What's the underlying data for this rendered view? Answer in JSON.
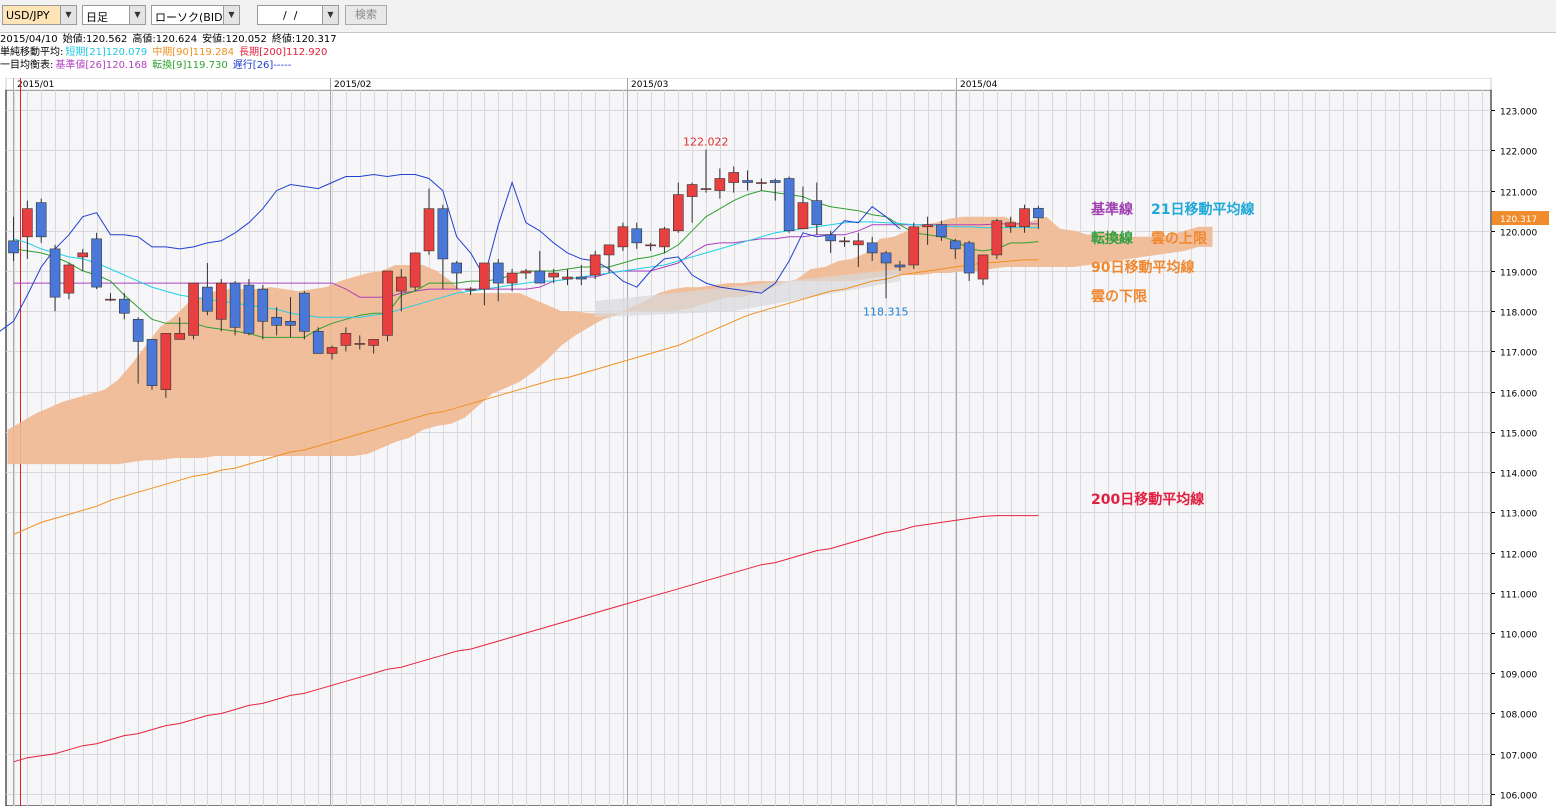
{
  "toolbar": {
    "symbol": "USD/JPY",
    "period": "日足",
    "chart_type": "ローソク(BID)",
    "date_value": "  /  /",
    "search_label": "検索"
  },
  "info": {
    "date": "2015/04/10",
    "open": "始値:120.562",
    "high": "高値:120.624",
    "low": "安値:120.052",
    "close": "終値:120.317",
    "sma_label": "単純移動平均:",
    "sma_short": "短期[21]120.079",
    "sma_mid": "中期[90]119.284",
    "sma_long": "長期[200]112.920",
    "ichimoku_label": "一目均衡表:",
    "kijun": "基準値[26]120.168",
    "tenkan": "転換[9]119.730",
    "chikou": "遅行[26]-----"
  },
  "colors": {
    "up": "#e84040",
    "down": "#4a78d8",
    "cloud": "#f0b890",
    "sma21": "#20d0e8",
    "sma90": "#f09020",
    "sma200": "#e8203c",
    "kijun": "#b040c0",
    "tenkan": "#30a030",
    "chikou": "#2040d0",
    "price_tag": "#f08c2c"
  },
  "annotations": {
    "kijun": "基準線",
    "sma21": "21日移動平均線",
    "tenkan": "転換線",
    "cloud_upper": "雲の上限",
    "sma90": "90日移動平均線",
    "cloud_lower": "雲の下限",
    "sma200": "200日移動平均線"
  },
  "chart_data": {
    "type": "candlestick",
    "title": "",
    "x_labels": [
      "2015/01",
      "2015/02",
      "2015/03",
      "2015/04"
    ],
    "y_ticks": [
      "123.000",
      "122.000",
      "121.000",
      "120.000",
      "119.000",
      "118.000",
      "117.000",
      "116.000",
      "115.000",
      "114.000",
      "113.000",
      "112.000",
      "111.000",
      "110.000",
      "109.000",
      "108.000",
      "107.000",
      "106.000"
    ],
    "ylim": [
      105.7,
      123.5
    ],
    "current_price": "120.317",
    "high_label": "122.022",
    "low_label": "118.315",
    "candles": [
      [
        119.75,
        120.35,
        119.25,
        119.45
      ],
      [
        119.85,
        120.75,
        119.3,
        120.55
      ],
      [
        120.7,
        120.8,
        119.7,
        119.85
      ],
      [
        119.55,
        119.65,
        118.0,
        118.35
      ],
      [
        118.45,
        119.2,
        118.3,
        119.15
      ],
      [
        119.35,
        119.55,
        119.0,
        119.45
      ],
      [
        119.8,
        119.95,
        118.55,
        118.6
      ],
      [
        118.3,
        118.45,
        118.25,
        118.3
      ],
      [
        118.3,
        118.45,
        117.8,
        117.95
      ],
      [
        117.8,
        117.85,
        116.2,
        117.25
      ],
      [
        117.3,
        117.3,
        116.05,
        116.15
      ],
      [
        116.05,
        117.35,
        115.85,
        117.45
      ],
      [
        117.3,
        117.85,
        117.3,
        117.45
      ],
      [
        117.4,
        118.7,
        117.3,
        118.7
      ],
      [
        118.6,
        119.2,
        117.9,
        118.0
      ],
      [
        117.8,
        118.8,
        117.5,
        118.7
      ],
      [
        118.7,
        118.75,
        117.4,
        117.6
      ],
      [
        118.65,
        118.8,
        117.4,
        117.45
      ],
      [
        118.55,
        118.65,
        117.3,
        117.75
      ],
      [
        117.85,
        118.1,
        117.4,
        117.65
      ],
      [
        117.75,
        118.35,
        117.35,
        117.65
      ],
      [
        118.45,
        118.5,
        117.3,
        117.5
      ],
      [
        117.5,
        117.6,
        116.95,
        116.95
      ],
      [
        116.95,
        117.15,
        116.8,
        117.1
      ],
      [
        117.15,
        117.6,
        117.0,
        117.45
      ],
      [
        117.2,
        117.4,
        117.05,
        117.2
      ],
      [
        117.15,
        117.3,
        116.95,
        117.3
      ],
      [
        117.4,
        118.75,
        117.25,
        119.0
      ],
      [
        118.5,
        119.05,
        118.0,
        118.85
      ],
      [
        118.6,
        119.45,
        118.5,
        119.45
      ],
      [
        119.5,
        121.05,
        119.4,
        120.55
      ],
      [
        120.55,
        120.65,
        118.55,
        119.3
      ],
      [
        119.2,
        119.25,
        118.55,
        118.95
      ],
      [
        118.55,
        118.6,
        118.4,
        118.55
      ],
      [
        118.55,
        119.1,
        118.15,
        119.2
      ],
      [
        119.2,
        119.3,
        118.25,
        118.7
      ],
      [
        118.7,
        119.05,
        118.5,
        118.95
      ],
      [
        118.95,
        119.05,
        118.8,
        119.0
      ],
      [
        119.0,
        119.5,
        118.7,
        118.7
      ],
      [
        118.85,
        119.05,
        118.7,
        118.95
      ],
      [
        118.8,
        119.05,
        118.65,
        118.85
      ],
      [
        118.85,
        119.15,
        118.65,
        118.8
      ],
      [
        118.9,
        119.5,
        118.8,
        119.4
      ],
      [
        119.4,
        119.65,
        118.95,
        119.65
      ],
      [
        119.6,
        120.2,
        119.5,
        120.1
      ],
      [
        120.05,
        120.2,
        119.55,
        119.7
      ],
      [
        119.65,
        119.7,
        119.5,
        119.65
      ],
      [
        119.6,
        120.1,
        119.45,
        120.05
      ],
      [
        120.0,
        121.2,
        119.95,
        120.9
      ],
      [
        120.85,
        121.2,
        120.2,
        121.15
      ],
      [
        121.05,
        122.02,
        120.95,
        121.05
      ],
      [
        121.0,
        121.55,
        120.8,
        121.3
      ],
      [
        121.2,
        121.6,
        120.95,
        121.45
      ],
      [
        121.25,
        121.5,
        121.0,
        121.2
      ],
      [
        121.2,
        121.3,
        121.0,
        121.2
      ],
      [
        121.25,
        121.3,
        120.75,
        121.2
      ],
      [
        121.3,
        121.35,
        119.95,
        120.0
      ],
      [
        120.05,
        121.1,
        120.05,
        120.7
      ],
      [
        120.75,
        121.2,
        119.9,
        120.15
      ],
      [
        119.9,
        120.0,
        119.45,
        119.75
      ],
      [
        119.75,
        119.85,
        119.6,
        119.75
      ],
      [
        119.65,
        119.95,
        119.1,
        119.75
      ],
      [
        119.7,
        119.85,
        119.25,
        119.45
      ],
      [
        119.45,
        119.5,
        118.32,
        119.2
      ],
      [
        119.15,
        119.25,
        119.0,
        119.1
      ],
      [
        119.15,
        120.2,
        119.05,
        120.1
      ],
      [
        120.1,
        120.35,
        119.65,
        120.15
      ],
      [
        120.15,
        120.25,
        119.75,
        119.85
      ],
      [
        119.75,
        119.8,
        119.3,
        119.55
      ],
      [
        119.7,
        119.75,
        118.75,
        118.95
      ],
      [
        118.8,
        119.4,
        118.65,
        119.4
      ],
      [
        119.4,
        120.3,
        119.3,
        120.25
      ],
      [
        120.1,
        120.35,
        119.95,
        120.2
      ],
      [
        120.1,
        120.65,
        119.95,
        120.55
      ],
      [
        120.56,
        120.62,
        120.05,
        120.32
      ]
    ],
    "sma21": [
      119.8,
      119.7,
      119.55,
      119.45,
      119.35,
      119.3,
      119.2,
      119.05,
      118.9,
      118.75,
      118.6,
      118.5,
      118.4,
      118.35,
      118.3,
      118.25,
      118.2,
      118.15,
      118.1,
      118.05,
      117.95,
      117.9,
      117.85,
      117.85,
      117.85,
      117.85,
      117.9,
      117.95,
      118.05,
      118.15,
      118.25,
      118.35,
      118.45,
      118.5,
      118.55,
      118.6,
      118.65,
      118.7,
      118.75,
      118.75,
      118.8,
      118.85,
      118.9,
      118.95,
      119.0,
      119.05,
      119.1,
      119.15,
      119.25,
      119.35,
      119.45,
      119.55,
      119.65,
      119.75,
      119.85,
      119.95,
      120.0,
      120.05,
      120.1,
      120.15,
      120.2,
      120.22,
      120.22,
      120.2,
      120.18,
      120.15,
      120.15,
      120.12,
      120.1,
      120.1,
      120.08,
      120.08,
      120.08,
      120.08,
      120.08
    ],
    "kijun": [
      118.7,
      118.7,
      118.7,
      118.7,
      118.7,
      118.7,
      118.7,
      118.7,
      118.7,
      118.7,
      118.7,
      118.7,
      118.7,
      118.7,
      118.7,
      118.7,
      118.7,
      118.7,
      118.7,
      118.7,
      118.7,
      118.7,
      118.7,
      118.7,
      118.55,
      118.35,
      118.35,
      118.35,
      118.45,
      118.5,
      118.55,
      118.55,
      118.55,
      118.55,
      118.55,
      118.55,
      118.55,
      118.55,
      118.6,
      118.75,
      118.8,
      118.85,
      118.85,
      118.95,
      119.0,
      119.0,
      119.0,
      119.1,
      119.2,
      119.45,
      119.65,
      119.7,
      119.7,
      119.75,
      119.8,
      119.8,
      119.85,
      119.85,
      119.9,
      119.9,
      119.9,
      120.0,
      120.15,
      120.15,
      120.15,
      120.15,
      120.15,
      120.15,
      120.15,
      120.15,
      120.15,
      120.17,
      120.17,
      120.17,
      120.17
    ],
    "tenkan": [
      119.55,
      119.5,
      119.45,
      119.35,
      119.2,
      119.0,
      118.9,
      118.75,
      118.4,
      118.1,
      117.8,
      117.7,
      117.7,
      117.7,
      117.6,
      117.55,
      117.5,
      117.45,
      117.35,
      117.35,
      117.35,
      117.35,
      117.55,
      117.7,
      117.8,
      117.9,
      117.95,
      117.95,
      118.4,
      118.5,
      118.7,
      118.7,
      118.7,
      118.75,
      118.75,
      118.8,
      118.9,
      119.0,
      119.0,
      119.0,
      119.05,
      119.1,
      119.1,
      119.1,
      119.2,
      119.3,
      119.35,
      119.45,
      119.65,
      120.0,
      120.35,
      120.55,
      120.75,
      120.9,
      121.0,
      120.95,
      120.9,
      120.85,
      120.7,
      120.6,
      120.55,
      120.5,
      120.4,
      120.35,
      120.15,
      119.95,
      119.9,
      119.85,
      119.75,
      119.55,
      119.5,
      119.55,
      119.7,
      119.7,
      119.73
    ],
    "chikou": [
      117.5,
      117.75,
      118.4,
      119.1,
      119.55,
      119.9,
      120.35,
      120.45,
      119.9,
      119.9,
      119.85,
      119.6,
      119.6,
      119.55,
      119.6,
      119.7,
      119.75,
      119.95,
      120.2,
      120.55,
      121.0,
      121.15,
      121.1,
      121.05,
      121.2,
      121.35,
      121.35,
      121.4,
      121.35,
      121.4,
      121.4,
      121.3,
      121.0,
      119.85,
      119.45,
      118.85,
      120.15,
      121.2,
      120.2,
      120.0,
      119.7,
      119.45,
      119.3,
      119.25,
      119.05,
      118.75,
      118.6,
      119.0,
      119.3,
      119.35,
      118.9,
      118.7,
      118.6,
      118.55,
      118.5,
      118.45,
      118.7,
      119.25,
      119.95,
      119.85,
      119.9,
      120.25,
      120.2,
      120.6,
      120.35,
      120.05
    ],
    "sma90": [
      112.45,
      112.6,
      112.75,
      112.85,
      112.95,
      113.05,
      113.15,
      113.3,
      113.4,
      113.5,
      113.6,
      113.7,
      113.8,
      113.9,
      113.95,
      114.05,
      114.1,
      114.2,
      114.3,
      114.4,
      114.5,
      114.55,
      114.65,
      114.75,
      114.85,
      114.95,
      115.05,
      115.15,
      115.25,
      115.35,
      115.45,
      115.5,
      115.6,
      115.7,
      115.8,
      115.9,
      116.0,
      116.1,
      116.2,
      116.3,
      116.35,
      116.45,
      116.55,
      116.65,
      116.75,
      116.85,
      116.95,
      117.05,
      117.15,
      117.3,
      117.45,
      117.6,
      117.75,
      117.9,
      118.0,
      118.1,
      118.2,
      118.3,
      118.4,
      118.5,
      118.55,
      118.65,
      118.75,
      118.8,
      118.9,
      118.95,
      119.0,
      119.05,
      119.1,
      119.15,
      119.2,
      119.22,
      119.25,
      119.28,
      119.28
    ],
    "sma200": [
      106.8,
      106.9,
      106.95,
      107.0,
      107.1,
      107.2,
      107.25,
      107.35,
      107.45,
      107.5,
      107.6,
      107.7,
      107.75,
      107.85,
      107.95,
      108.0,
      108.1,
      108.2,
      108.25,
      108.35,
      108.45,
      108.5,
      108.6,
      108.7,
      108.8,
      108.9,
      109.0,
      109.1,
      109.15,
      109.25,
      109.35,
      109.45,
      109.55,
      109.6,
      109.7,
      109.8,
      109.9,
      110.0,
      110.1,
      110.2,
      110.3,
      110.4,
      110.5,
      110.6,
      110.7,
      110.8,
      110.9,
      111.0,
      111.1,
      111.2,
      111.3,
      111.4,
      111.5,
      111.6,
      111.7,
      111.75,
      111.85,
      111.95,
      112.05,
      112.1,
      112.2,
      112.3,
      112.4,
      112.5,
      112.55,
      112.65,
      112.7,
      112.75,
      112.8,
      112.85,
      112.9,
      112.92,
      112.92,
      112.92,
      112.92
    ],
    "cloud_upper": [
      115.05,
      115.25,
      115.45,
      115.6,
      115.75,
      115.85,
      115.95,
      116.05,
      116.3,
      116.7,
      117.15,
      117.6,
      117.85,
      118.2,
      118.35,
      118.5,
      118.55,
      118.55,
      118.55,
      118.6,
      118.55,
      118.5,
      118.55,
      118.6,
      118.75,
      118.85,
      118.95,
      119.0,
      119.15,
      119.15,
      119.15,
      119.0,
      118.75,
      118.45,
      118.45,
      118.45,
      118.45,
      118.45,
      118.3,
      118.15,
      118.0,
      118.0,
      117.95,
      117.95,
      117.95,
      118.0,
      118.0,
      118.0,
      118.0,
      118.05,
      118.15,
      118.25,
      118.35,
      118.35,
      118.45,
      118.55,
      118.7,
      118.8,
      119.05,
      119.1,
      119.25,
      119.3,
      119.45,
      119.8,
      119.85,
      120.0,
      120.15,
      120.2,
      120.3,
      120.35,
      120.35,
      120.35,
      120.35,
      120.2,
      120.25,
      120.35,
      120.05,
      120.0,
      119.9,
      119.95,
      119.95,
      119.85,
      119.85,
      119.85,
      119.9,
      120.0,
      120.1,
      120.1
    ],
    "cloud_lower": [
      114.2,
      114.2,
      114.2,
      114.2,
      114.2,
      114.2,
      114.2,
      114.2,
      114.2,
      114.25,
      114.3,
      114.3,
      114.35,
      114.35,
      114.35,
      114.4,
      114.4,
      114.4,
      114.4,
      114.4,
      114.4,
      114.4,
      114.4,
      114.4,
      114.4,
      114.4,
      114.45,
      114.6,
      114.75,
      114.85,
      115.05,
      115.15,
      115.2,
      115.35,
      115.65,
      115.95,
      116.1,
      116.25,
      116.5,
      116.8,
      117.15,
      117.4,
      117.6,
      117.8,
      117.9,
      118.1,
      118.25,
      118.45,
      118.55,
      118.6,
      118.6,
      118.65,
      118.7,
      118.7,
      118.75,
      118.75,
      118.75,
      118.75,
      118.75,
      118.75,
      118.75,
      118.75,
      118.8,
      118.85,
      118.9,
      118.9,
      118.9,
      118.95,
      118.95,
      119.0,
      119.0,
      119.05,
      119.1,
      119.1,
      119.1,
      119.1,
      119.1,
      119.1,
      119.15,
      119.2,
      119.25,
      119.3,
      119.35,
      119.4,
      119.45,
      119.5,
      119.6,
      119.6
    ]
  }
}
